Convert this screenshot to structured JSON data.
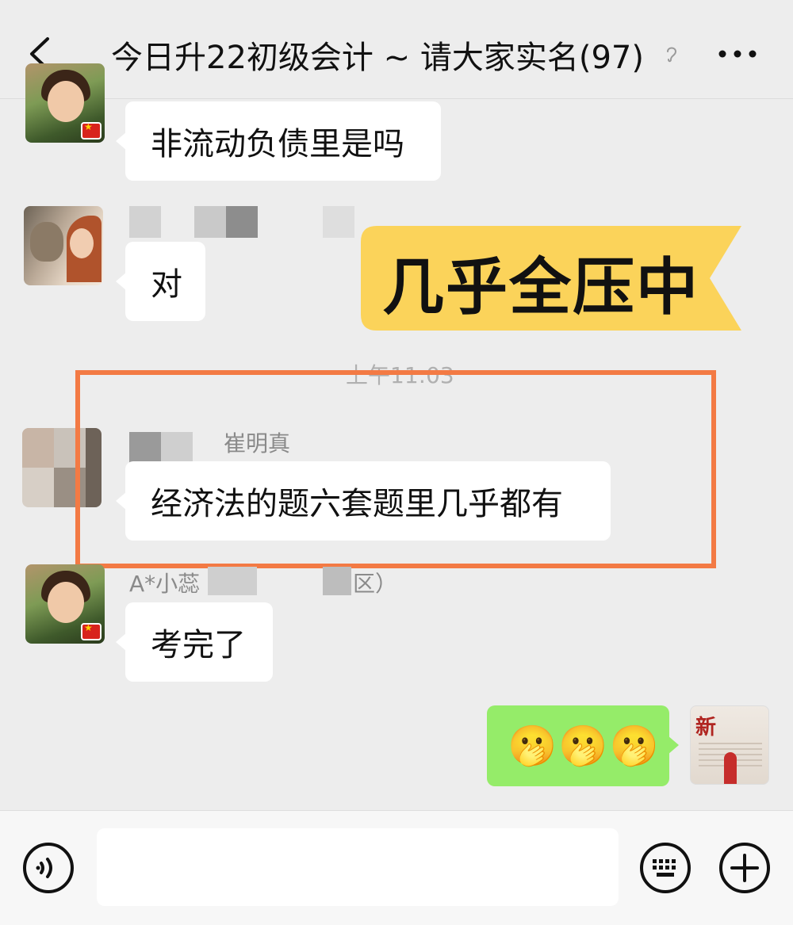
{
  "header": {
    "title": "今日升22初级会计 ~ 请大家实名(97)",
    "back_icon": "chevron-left-icon",
    "ear_icon": "ear-icon",
    "more_icon": "more-dots-icon"
  },
  "messages": [
    {
      "id": "m1",
      "sender_name": "",
      "text": "非流动负债里是吗"
    },
    {
      "id": "m2",
      "sender_name": "",
      "text": "对"
    },
    {
      "id": "m3",
      "sender_name": "崔明真",
      "text": "经济法的题六套题里几乎都有"
    },
    {
      "id": "m4",
      "sender_name": "A*小蕊",
      "sender_suffix": "区）",
      "text": "考完了"
    },
    {
      "id": "m5",
      "text": "🫢🫢🫢"
    }
  ],
  "timestamp": "上午11:03",
  "banner": {
    "text": "几乎全压中",
    "color": "#fbd35a"
  },
  "highlight": {
    "color": "#f37a44"
  },
  "input_bar": {
    "voice_icon": "voice-icon",
    "keyboard_icon": "keyboard-icon",
    "plus_icon": "plus-icon",
    "placeholder": ""
  },
  "colors": {
    "background": "#ededed",
    "bubble_other": "#ffffff",
    "bubble_self": "#95ec69"
  }
}
